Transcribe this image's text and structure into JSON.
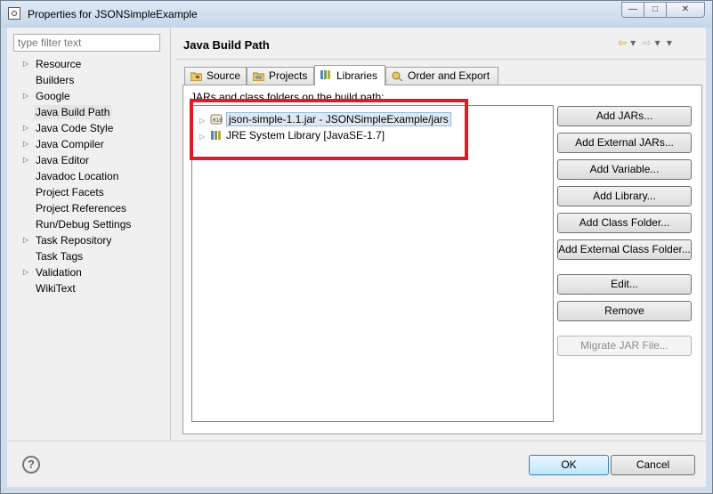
{
  "window": {
    "title": "Properties for JSONSimpleExample",
    "controls": {
      "minimize": "—",
      "maximize": "□",
      "close": "✕"
    }
  },
  "sidebar": {
    "filter_placeholder": "type filter text",
    "items": [
      {
        "label": "Resource",
        "expandable": true
      },
      {
        "label": "Builders",
        "expandable": false
      },
      {
        "label": "Google",
        "expandable": true
      },
      {
        "label": "Java Build Path",
        "expandable": false,
        "selected": true
      },
      {
        "label": "Java Code Style",
        "expandable": true
      },
      {
        "label": "Java Compiler",
        "expandable": true
      },
      {
        "label": "Java Editor",
        "expandable": true
      },
      {
        "label": "Javadoc Location",
        "expandable": false
      },
      {
        "label": "Project Facets",
        "expandable": false
      },
      {
        "label": "Project References",
        "expandable": false
      },
      {
        "label": "Run/Debug Settings",
        "expandable": false
      },
      {
        "label": "Task Repository",
        "expandable": true
      },
      {
        "label": "Task Tags",
        "expandable": false
      },
      {
        "label": "Validation",
        "expandable": true
      },
      {
        "label": "WikiText",
        "expandable": false
      }
    ]
  },
  "page": {
    "title": "Java Build Path",
    "history_nav": {
      "back": "⇦",
      "back_menu": "▾",
      "forward": "⇨",
      "forward_menu": "▾",
      "view_menu": "▾"
    }
  },
  "tabs": [
    {
      "label": "Source",
      "icon": "source-folder-icon"
    },
    {
      "label": "Projects",
      "icon": "projects-icon"
    },
    {
      "label": "Libraries",
      "icon": "libraries-icon",
      "active": true
    },
    {
      "label": "Order and Export",
      "icon": "order-export-icon"
    }
  ],
  "libraries": {
    "label": "JARs and class folders on the build path:",
    "entries": [
      {
        "label": "json-simple-1.1.jar - JSONSimpleExample/jars",
        "icon": "jar-icon",
        "selected": true
      },
      {
        "label": "JRE System Library [JavaSE-1.7]",
        "icon": "library-icon",
        "selected": false
      }
    ],
    "buttons": {
      "add_jars": "Add JARs...",
      "add_external_jars": "Add External JARs...",
      "add_variable": "Add Variable...",
      "add_library": "Add Library...",
      "add_class_folder": "Add Class Folder...",
      "add_external_class_folder": "Add External Class Folder...",
      "edit": "Edit...",
      "remove": "Remove",
      "migrate_jar": "Migrate JAR File..."
    }
  },
  "footer": {
    "help": "?",
    "ok": "OK",
    "cancel": "Cancel"
  },
  "colors": {
    "highlight_box": "#e01b24",
    "selection_bg": "#dde8f3"
  }
}
